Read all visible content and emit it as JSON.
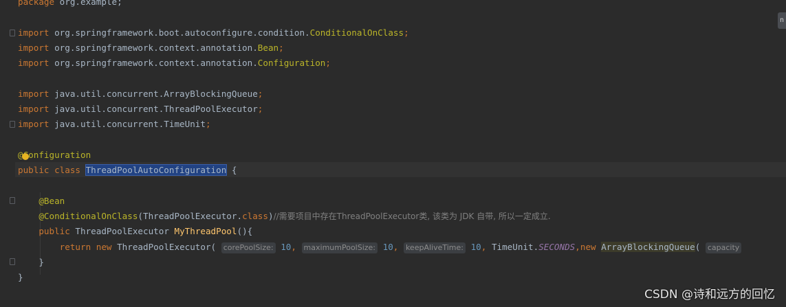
{
  "editor": {
    "lines": [
      [
        {
          "t": "package",
          "c": "kw"
        },
        {
          "t": " org.example;",
          "c": ""
        }
      ],
      [],
      [
        {
          "t": "import",
          "c": "kw"
        },
        {
          "t": " org.springframework.boot.autoconfigure.condition.",
          "c": ""
        },
        {
          "t": "ConditionalOnClass",
          "c": "ann"
        },
        {
          "t": ";",
          "c": "kw"
        }
      ],
      [
        {
          "t": "import",
          "c": "kw"
        },
        {
          "t": " org.springframework.context.annotation.",
          "c": ""
        },
        {
          "t": "Bean",
          "c": "ann"
        },
        {
          "t": ";",
          "c": "kw"
        }
      ],
      [
        {
          "t": "import",
          "c": "kw"
        },
        {
          "t": " org.springframework.context.annotation.",
          "c": ""
        },
        {
          "t": "Configuration",
          "c": "ann"
        },
        {
          "t": ";",
          "c": "kw"
        }
      ],
      [],
      [
        {
          "t": "import",
          "c": "kw"
        },
        {
          "t": " java.util.concurrent.ArrayBlockingQueue",
          "c": ""
        },
        {
          "t": ";",
          "c": "kw"
        }
      ],
      [
        {
          "t": "import",
          "c": "kw"
        },
        {
          "t": " java.util.concurrent.ThreadPoolExecutor",
          "c": ""
        },
        {
          "t": ";",
          "c": "kw"
        }
      ],
      [
        {
          "t": "import",
          "c": "kw"
        },
        {
          "t": " java.util.concurrent.TimeUnit",
          "c": ""
        },
        {
          "t": ";",
          "c": "kw"
        }
      ],
      [],
      [
        {
          "t": "@Configuration",
          "c": "ann"
        }
      ],
      [
        {
          "t": "public class ",
          "c": "kw"
        },
        {
          "t": "ThreadPoolAutoConfiguration",
          "c": "cls-hl"
        },
        {
          "t": " {",
          "c": ""
        }
      ],
      [],
      [
        {
          "t": "    ",
          "c": ""
        },
        {
          "t": "@Bean",
          "c": "ann"
        }
      ],
      [
        {
          "t": "    ",
          "c": ""
        },
        {
          "t": "@ConditionalOnClass",
          "c": "ann"
        },
        {
          "t": "(ThreadPoolExecutor.",
          "c": ""
        },
        {
          "t": "class",
          "c": "kw"
        },
        {
          "t": ")",
          "c": ""
        },
        {
          "t": "//需要项目中存在ThreadPoolExecutor类, 该类为 JDK 自带, 所以一定成立.",
          "c": "cmt"
        }
      ],
      [
        {
          "t": "    ",
          "c": ""
        },
        {
          "t": "public ",
          "c": "kw"
        },
        {
          "t": "ThreadPoolExecutor ",
          "c": ""
        },
        {
          "t": "MyThreadPool",
          "c": "fn"
        },
        {
          "t": "(){",
          "c": ""
        }
      ],
      [
        {
          "t": "        ",
          "c": ""
        },
        {
          "t": "return new ",
          "c": "kw"
        },
        {
          "t": "ThreadPoolExecutor( ",
          "c": ""
        },
        {
          "t": "corePoolSize:",
          "c": "hint"
        },
        {
          "t": " ",
          "c": ""
        },
        {
          "t": "10",
          "c": "num"
        },
        {
          "t": ", ",
          "c": "kw"
        },
        {
          "t": "maximumPoolSize:",
          "c": "hint"
        },
        {
          "t": " ",
          "c": ""
        },
        {
          "t": "10",
          "c": "num"
        },
        {
          "t": ", ",
          "c": "kw"
        },
        {
          "t": "keepAliveTime:",
          "c": "hint"
        },
        {
          "t": " ",
          "c": ""
        },
        {
          "t": "10",
          "c": "num"
        },
        {
          "t": ", ",
          "c": "kw"
        },
        {
          "t": "TimeUnit.",
          "c": ""
        },
        {
          "t": "SECONDS",
          "c": "const"
        },
        {
          "t": ",",
          "c": "kw"
        },
        {
          "t": "new ",
          "c": "kw"
        },
        {
          "t": "ArrayBlockingQueue",
          "c": "queue-hl"
        },
        {
          "t": "( ",
          "c": ""
        },
        {
          "t": "capacity",
          "c": "hint"
        }
      ],
      [
        {
          "t": "    }",
          "c": ""
        }
      ],
      [
        {
          "t": "}",
          "c": ""
        }
      ]
    ]
  },
  "right_chip_label": "n",
  "watermark": "CSDN @诗和远方的回忆"
}
